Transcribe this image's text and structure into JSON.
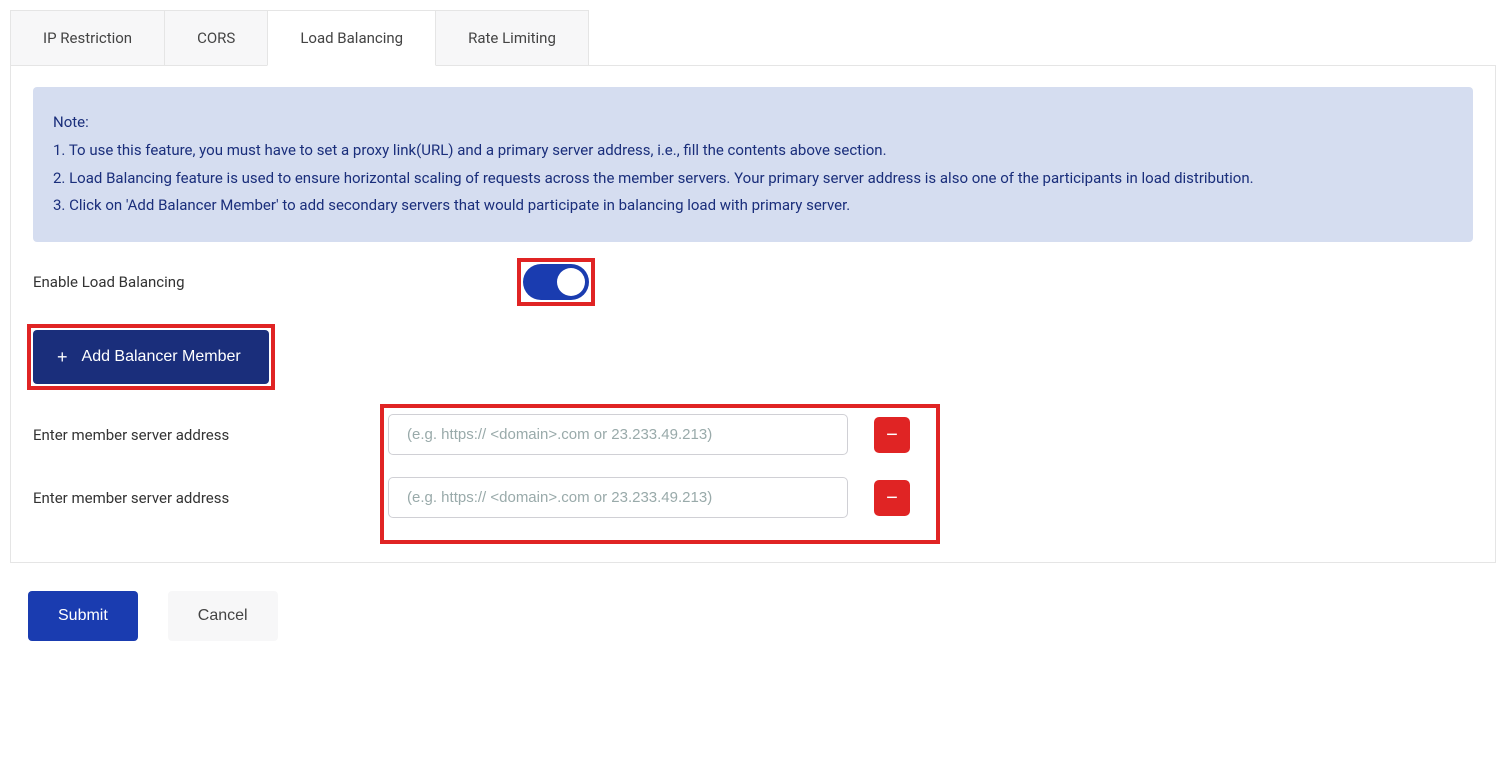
{
  "tabs": [
    {
      "label": "IP Restriction",
      "active": false
    },
    {
      "label": "CORS",
      "active": false
    },
    {
      "label": "Load Balancing",
      "active": true
    },
    {
      "label": "Rate Limiting",
      "active": false
    }
  ],
  "note": {
    "heading": "Note:",
    "line1": "1. To use this feature, you must have to set a proxy link(URL) and a primary server address, i.e., fill the contents above section.",
    "line2": "2. Load Balancing feature is used to ensure horizontal scaling of requests across the member servers. Your primary server address is also one of the participants in load distribution.",
    "line3": "3. Click on 'Add Balancer Member' to add secondary servers that would participate in balancing load with primary server."
  },
  "enable": {
    "label": "Enable Load Balancing",
    "on": true
  },
  "addButton": {
    "label": "Add Balancer Member"
  },
  "members": [
    {
      "label": "Enter member server address",
      "placeholder": "(e.g. https:// <domain>.com or 23.233.49.213)",
      "value": ""
    },
    {
      "label": "Enter member server address",
      "placeholder": "(e.g. https:// <domain>.com or 23.233.49.213)",
      "value": ""
    }
  ],
  "footer": {
    "submit": "Submit",
    "cancel": "Cancel"
  }
}
